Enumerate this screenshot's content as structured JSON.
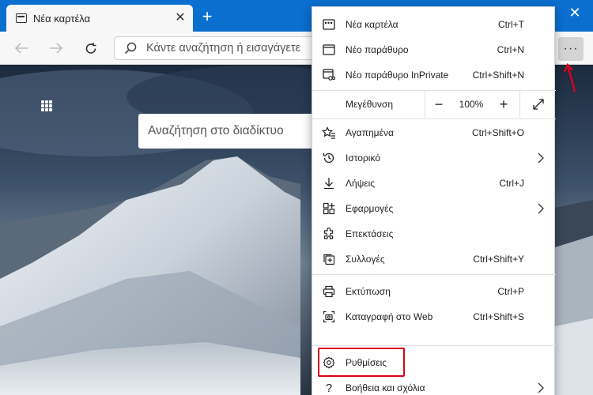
{
  "tab": {
    "title": "Νέα καρτέλα"
  },
  "address": {
    "placeholder": "Κάντε αναζήτηση ή εισαγάγετε"
  },
  "page": {
    "search_placeholder": "Αναζήτηση στο διαδίκτυο"
  },
  "menu": {
    "items": [
      {
        "label": "Νέα καρτέλα",
        "shortcut": "Ctrl+T",
        "icon": "new-tab-icon"
      },
      {
        "label": "Νέο παράθυρο",
        "shortcut": "Ctrl+N",
        "icon": "new-window-icon"
      },
      {
        "label": "Νέο παράθυρο InPrivate",
        "shortcut": "Ctrl+Shift+N",
        "icon": "inprivate-icon"
      },
      {
        "label": "Αγαπημένα",
        "shortcut": "Ctrl+Shift+O",
        "icon": "favorites-icon"
      },
      {
        "label": "Ιστορικό",
        "shortcut": "",
        "icon": "history-icon"
      },
      {
        "label": "Λήψεις",
        "shortcut": "Ctrl+J",
        "icon": "downloads-icon"
      },
      {
        "label": "Εφαρμογές",
        "shortcut": "",
        "icon": "apps-icon"
      },
      {
        "label": "Επεκτάσεις",
        "shortcut": "",
        "icon": "extensions-icon"
      },
      {
        "label": "Συλλογές",
        "shortcut": "Ctrl+Shift+Y",
        "icon": "collections-icon"
      },
      {
        "label": "Εκτύπωση",
        "shortcut": "Ctrl+P",
        "icon": "print-icon"
      },
      {
        "label": "Καταγραφή στο Web",
        "shortcut": "Ctrl+Shift+S",
        "icon": "web-capture-icon"
      },
      {
        "label": "Ρυθμίσεις",
        "shortcut": "",
        "icon": "settings-icon"
      },
      {
        "label": "Βοήθεια και σχόλια",
        "shortcut": "",
        "icon": "help-icon"
      }
    ],
    "zoom": {
      "label": "Μεγέθυνση",
      "value": "100%",
      "minus": "−",
      "plus": "+"
    }
  },
  "colors": {
    "accent": "#0a6fcf",
    "highlight": "#e0001b"
  }
}
